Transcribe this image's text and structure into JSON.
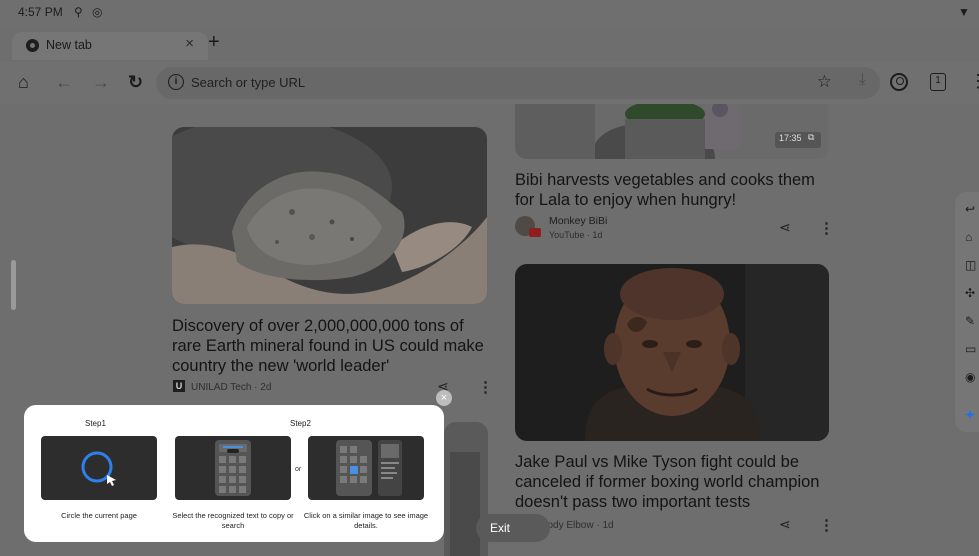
{
  "status_bar": {
    "time": "4:57 PM",
    "icons": [
      "usb-icon",
      "sync-icon",
      "wifi-icon"
    ]
  },
  "tabs": [
    {
      "title": "New tab",
      "icon": "chrome-icon"
    }
  ],
  "toolbar": {
    "omnibox_placeholder": "Search or type URL",
    "tab_count": "1"
  },
  "feed": {
    "left": [
      {
        "headline": "Discovery of over 2,000,000,000 tons of rare Earth mineral found in US could make country the new 'world leader'",
        "source": "UNILAD Tech · 2d",
        "source_logo": "U"
      }
    ],
    "right": [
      {
        "video_duration": "17:35",
        "headline": "Bibi harvests vegetables and cooks them for Lala to enjoy when hungry!",
        "source_name": "Monkey BiBi",
        "source_meta": "YouTube · 1d"
      },
      {
        "headline": "Jake Paul vs Mike Tyson fight could be canceled if former boxing world champion doesn't pass two important tests",
        "source": "Bloody Elbow · 1d"
      }
    ]
  },
  "circle_to_search": {
    "step1": "Step1",
    "step2": "Step2",
    "or": "or",
    "captions": [
      "Circle the current page",
      "Select the recognized text to copy or search",
      "Click on a similar image to see image details."
    ],
    "close": "×",
    "exit": "Exit"
  }
}
